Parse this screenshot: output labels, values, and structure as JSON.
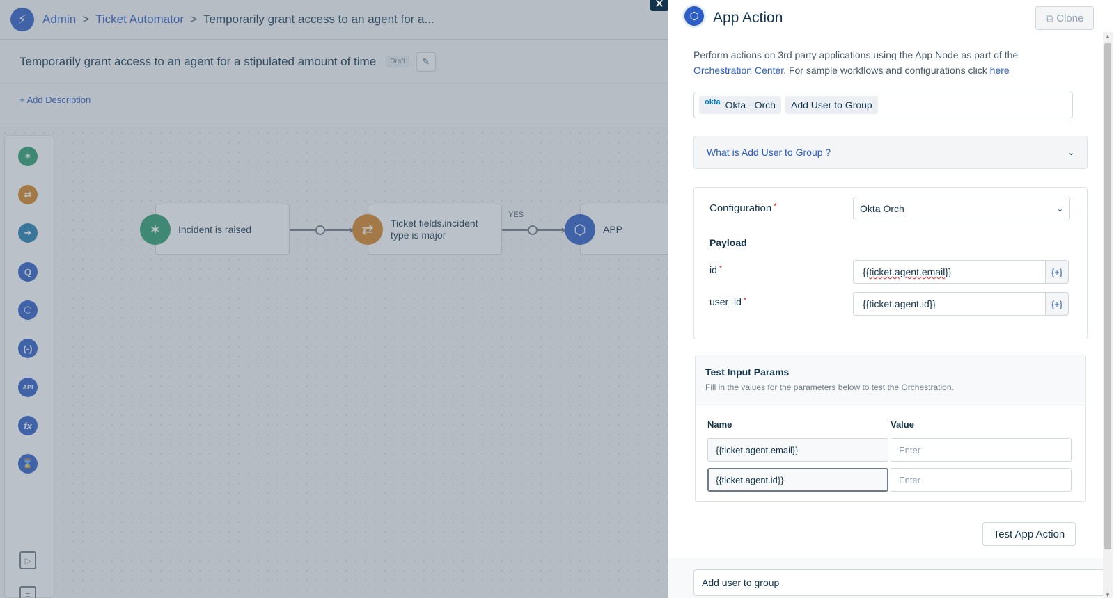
{
  "breadcrumb": {
    "items": [
      "Admin",
      "Ticket Automator"
    ],
    "separator": ">",
    "current": "Temporarily grant access to an agent for a..."
  },
  "workflow": {
    "title": "Temporarily grant access to an agent for a stipulated amount of time",
    "status": "Draft",
    "add_description": "+ Add Description"
  },
  "palette": {
    "items": [
      {
        "icon": "trigger-icon",
        "color": "#2a9d6f"
      },
      {
        "icon": "condition-icon",
        "color": "#d68521"
      },
      {
        "icon": "action-icon",
        "color": "#1f7fb0"
      },
      {
        "icon": "query-icon",
        "color": "#2c5cc5"
      },
      {
        "icon": "app-icon",
        "color": "#2c5cc5"
      },
      {
        "icon": "expression-icon",
        "color": "#2c5cc5"
      },
      {
        "icon": "api-icon",
        "color": "#2c5cc5"
      },
      {
        "icon": "function-icon",
        "color": "#2c5cc5"
      },
      {
        "icon": "timer-icon",
        "color": "#2c5cc5"
      }
    ]
  },
  "flow": {
    "nodes": [
      {
        "label": "Incident is raised",
        "color": "#2a9d6f",
        "icon": "trigger-icon"
      },
      {
        "label": "Ticket fields.incident type is major",
        "color": "#d68521",
        "icon": "condition-icon"
      },
      {
        "label": "APP",
        "color": "#2c5cc5",
        "icon": "app-icon"
      }
    ],
    "edge_label": "YES"
  },
  "panel": {
    "title": "App Action",
    "clone_label": "Clone",
    "description_pre": "Perform actions on 3rd party applications using the App Node as part of the ",
    "description_link1": "Orchestration Center",
    "description_mid": ". For sample workflows and configurations click ",
    "description_link2": "here",
    "app_chip_logo": "okta",
    "app_chip": "Okta - Orch",
    "action_chip": "Add User to Group",
    "accordion_title": "What is Add User to Group ?",
    "configuration_label": "Configuration",
    "configuration_value": "Okta Orch",
    "payload_title": "Payload",
    "fields": [
      {
        "label": "id",
        "value_prefix": "{{",
        "value_main": "ticket.agent.email",
        "value_suffix": "}}",
        "addon": "{+}"
      },
      {
        "label": "user_id",
        "value": "{{ticket.agent.id}}",
        "addon": "{+}"
      }
    ],
    "test": {
      "title": "Test Input Params",
      "subtitle": "Fill in the values for the parameters below to test the Orchestration.",
      "name_header": "Name",
      "value_header": "Value",
      "rows": [
        {
          "name": "{{ticket.agent.email}}",
          "value_placeholder": "Enter"
        },
        {
          "name": "{{ticket.agent.id}}",
          "value_placeholder": "Enter"
        }
      ],
      "button": "Test App Action"
    },
    "footer_value": "Add user to group"
  }
}
